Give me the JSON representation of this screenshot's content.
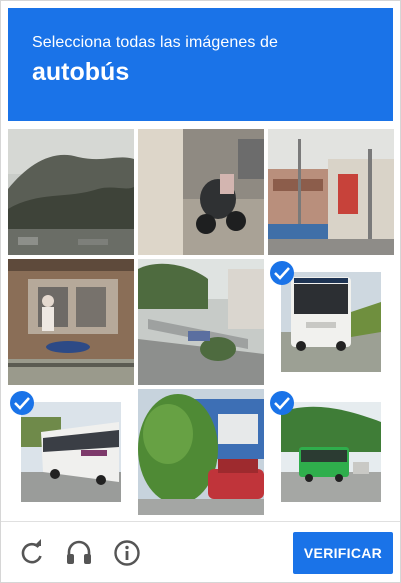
{
  "header": {
    "instruction": "Selecciona todas las imágenes de",
    "target": "autobús"
  },
  "tiles": [
    {
      "scene": "misty-hills",
      "selected": false
    },
    {
      "scene": "scooter-sidewalk",
      "selected": false
    },
    {
      "scene": "street-storefronts",
      "selected": false
    },
    {
      "scene": "shop-cyclist",
      "selected": false
    },
    {
      "scene": "parking-ramp",
      "selected": false
    },
    {
      "scene": "white-bus",
      "selected": true
    },
    {
      "scene": "city-bus-street",
      "selected": true
    },
    {
      "scene": "tree-red-car",
      "selected": false
    },
    {
      "scene": "green-bus",
      "selected": true
    }
  ],
  "footer": {
    "reload_icon": "reload-icon",
    "audio_icon": "headphones-icon",
    "info_icon": "info-icon",
    "verify_label": "VERIFICAR"
  },
  "colors": {
    "accent": "#1a73e8",
    "divider": "#e0e0e0",
    "icon": "#555555"
  }
}
